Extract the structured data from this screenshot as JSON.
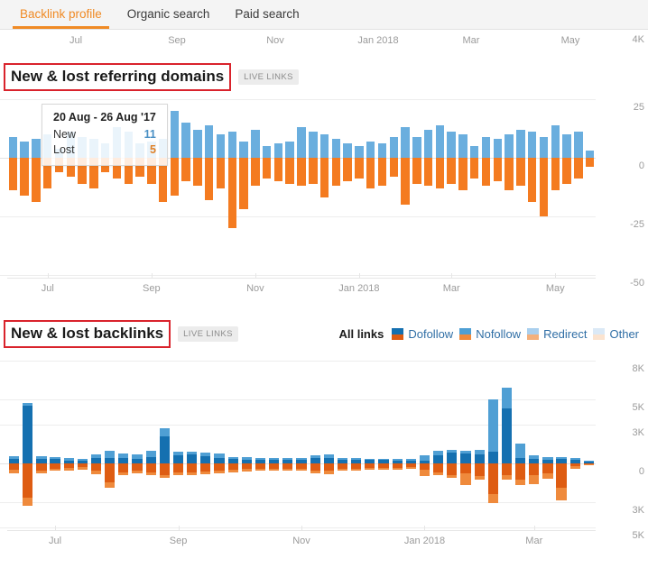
{
  "nav": {
    "tabs": [
      {
        "label": "Backlink profile",
        "active": true
      },
      {
        "label": "Organic search",
        "active": false
      },
      {
        "label": "Paid search",
        "active": false
      }
    ]
  },
  "colors": {
    "accent": "#f08a24",
    "new_blue": "#6aaede",
    "lost_orange": "#f47b20",
    "dofollow_blue": "#1570b0",
    "nofollow_blue": "#7cb5e8",
    "dofollow_orange": "#de5c12",
    "nofollow_orange": "#ef8a3c",
    "redirect_blue": "#a9cfee",
    "redirect_orange": "#f3b07c",
    "other_blue": "#dbe9f6",
    "other_orange": "#fbe3cf",
    "highlight_box": "#d9232c"
  },
  "cutoff_chart": {
    "ylabel_top": "4K",
    "xlabels": [
      "Jul",
      "Sep",
      "Nov",
      "Jan 2018",
      "Mar",
      "May"
    ]
  },
  "referring_domains": {
    "title": "New & lost referring domains",
    "badge": "LIVE LINKS",
    "tooltip": {
      "date": "20 Aug - 26 Aug '17",
      "rows": [
        {
          "label": "New",
          "value": "11"
        },
        {
          "label": "Lost",
          "value": "5"
        }
      ]
    }
  },
  "backlinks": {
    "title": "New & lost backlinks",
    "badge": "LIVE LINKS",
    "legend": {
      "title": "All links",
      "items": [
        {
          "label": "Dofollow",
          "top": "#1570b0",
          "bottom": "#de5c12"
        },
        {
          "label": "Nofollow",
          "top": "#4f9fd4",
          "bottom": "#ef8a3c"
        },
        {
          "label": "Redirect",
          "top": "#a9cfee",
          "bottom": "#f3b07c"
        },
        {
          "label": "Other",
          "top": "#dbe9f6",
          "bottom": "#fbe3cf"
        }
      ]
    }
  },
  "chart_data": [
    {
      "type": "bar",
      "title": "New & lost referring domains",
      "xlabel": "",
      "ylabel": "",
      "ylim": [
        -50,
        25
      ],
      "yticks": [
        25,
        0,
        -25,
        -50
      ],
      "ytick_labels": [
        "25",
        "0",
        "-25",
        "-50"
      ],
      "grid": true,
      "xlabels": [
        "Jul",
        "Sep",
        "Nov",
        "Jan 2018",
        "Mar",
        "May"
      ],
      "xlabel_indices": [
        3,
        12,
        21,
        30,
        38,
        47
      ],
      "series": [
        {
          "name": "New",
          "color": "#6aaede",
          "values": [
            9,
            7,
            8,
            10,
            4,
            11,
            9,
            8,
            6,
            13,
            11,
            6,
            7,
            8,
            20,
            15,
            12,
            14,
            10,
            11,
            7,
            12,
            5,
            6,
            7,
            13,
            11,
            10,
            8,
            6,
            5,
            7,
            6,
            9,
            13,
            9,
            12,
            14,
            11,
            10,
            5,
            9,
            8,
            10,
            12,
            11,
            9,
            14,
            10,
            11,
            3
          ]
        },
        {
          "name": "Lost",
          "color": "#f47b20",
          "values": [
            -14,
            -16,
            -19,
            -13,
            -6,
            -8,
            -11,
            -13,
            -6,
            -9,
            -11,
            -8,
            -11,
            -19,
            -16,
            -10,
            -12,
            -18,
            -13,
            -30,
            -22,
            -12,
            -9,
            -10,
            -11,
            -12,
            -11,
            -17,
            -12,
            -10,
            -9,
            -13,
            -12,
            -8,
            -20,
            -11,
            -12,
            -13,
            -11,
            -14,
            -9,
            -12,
            -10,
            -14,
            -12,
            -19,
            -25,
            -14,
            -11,
            -9,
            -4
          ]
        }
      ]
    },
    {
      "type": "bar",
      "title": "New & lost backlinks",
      "xlabel": "",
      "ylabel": "",
      "ylim": [
        -5000,
        8000
      ],
      "yticks": [
        8000,
        5000,
        3000,
        0,
        -3000,
        -5000
      ],
      "ytick_labels": [
        "8K",
        "5K",
        "3K",
        "0",
        "3K",
        "5K"
      ],
      "grid": true,
      "xlabels": [
        "Jul",
        "Sep",
        "Nov",
        "Jan 2018",
        "Mar",
        "May"
      ],
      "xlabel_indices": [
        3,
        12,
        21,
        30,
        38,
        47
      ],
      "stacked": true,
      "series": [
        {
          "name": "Dofollow",
          "color": "#1570b0",
          "values": [
            330,
            4500,
            330,
            330,
            230,
            230,
            400,
            400,
            380,
            350,
            500,
            2100,
            620,
            700,
            560,
            430,
            330,
            300,
            280,
            250,
            250,
            280,
            400,
            430,
            280,
            260,
            250,
            240,
            230,
            220,
            200,
            600,
            800,
            750,
            700,
            900,
            4300,
            420,
            370,
            300,
            330,
            280,
            120
          ]
        },
        {
          "name": "Nofollow",
          "color": "#4f9fd4",
          "values": [
            220,
            180,
            200,
            150,
            150,
            130,
            300,
            550,
            350,
            330,
            480,
            600,
            250,
            200,
            300,
            320,
            180,
            160,
            140,
            130,
            130,
            150,
            220,
            260,
            140,
            120,
            120,
            110,
            100,
            100,
            450,
            380,
            250,
            200,
            320,
            4100,
            1600,
            1100,
            260,
            200,
            180,
            160,
            60
          ]
        },
        {
          "name": "Lost dofollow",
          "color": "#de5c12",
          "values": [
            -500,
            -2700,
            -600,
            -420,
            -380,
            -320,
            -600,
            -1500,
            -700,
            -600,
            -700,
            -900,
            -700,
            -700,
            -620,
            -600,
            -520,
            -450,
            -420,
            -400,
            -400,
            -420,
            -600,
            -600,
            -420,
            -400,
            -380,
            -360,
            -340,
            -320,
            -520,
            -700,
            -900,
            -800,
            -1000,
            -2400,
            -900,
            -1300,
            -900,
            -800,
            -1900,
            -250,
            -60
          ]
        },
        {
          "name": "Lost nofollow",
          "color": "#ef8a3c",
          "values": [
            -250,
            -600,
            -200,
            -180,
            -160,
            -150,
            -250,
            -400,
            -200,
            -180,
            -200,
            -260,
            -220,
            -200,
            -200,
            -200,
            -180,
            -160,
            -150,
            -150,
            -140,
            -160,
            -200,
            -220,
            -160,
            -150,
            -140,
            -140,
            -130,
            -130,
            -500,
            -260,
            -260,
            -900,
            -300,
            -700,
            -400,
            -400,
            -700,
            -400,
            -1000,
            -150,
            -30
          ]
        }
      ]
    }
  ]
}
